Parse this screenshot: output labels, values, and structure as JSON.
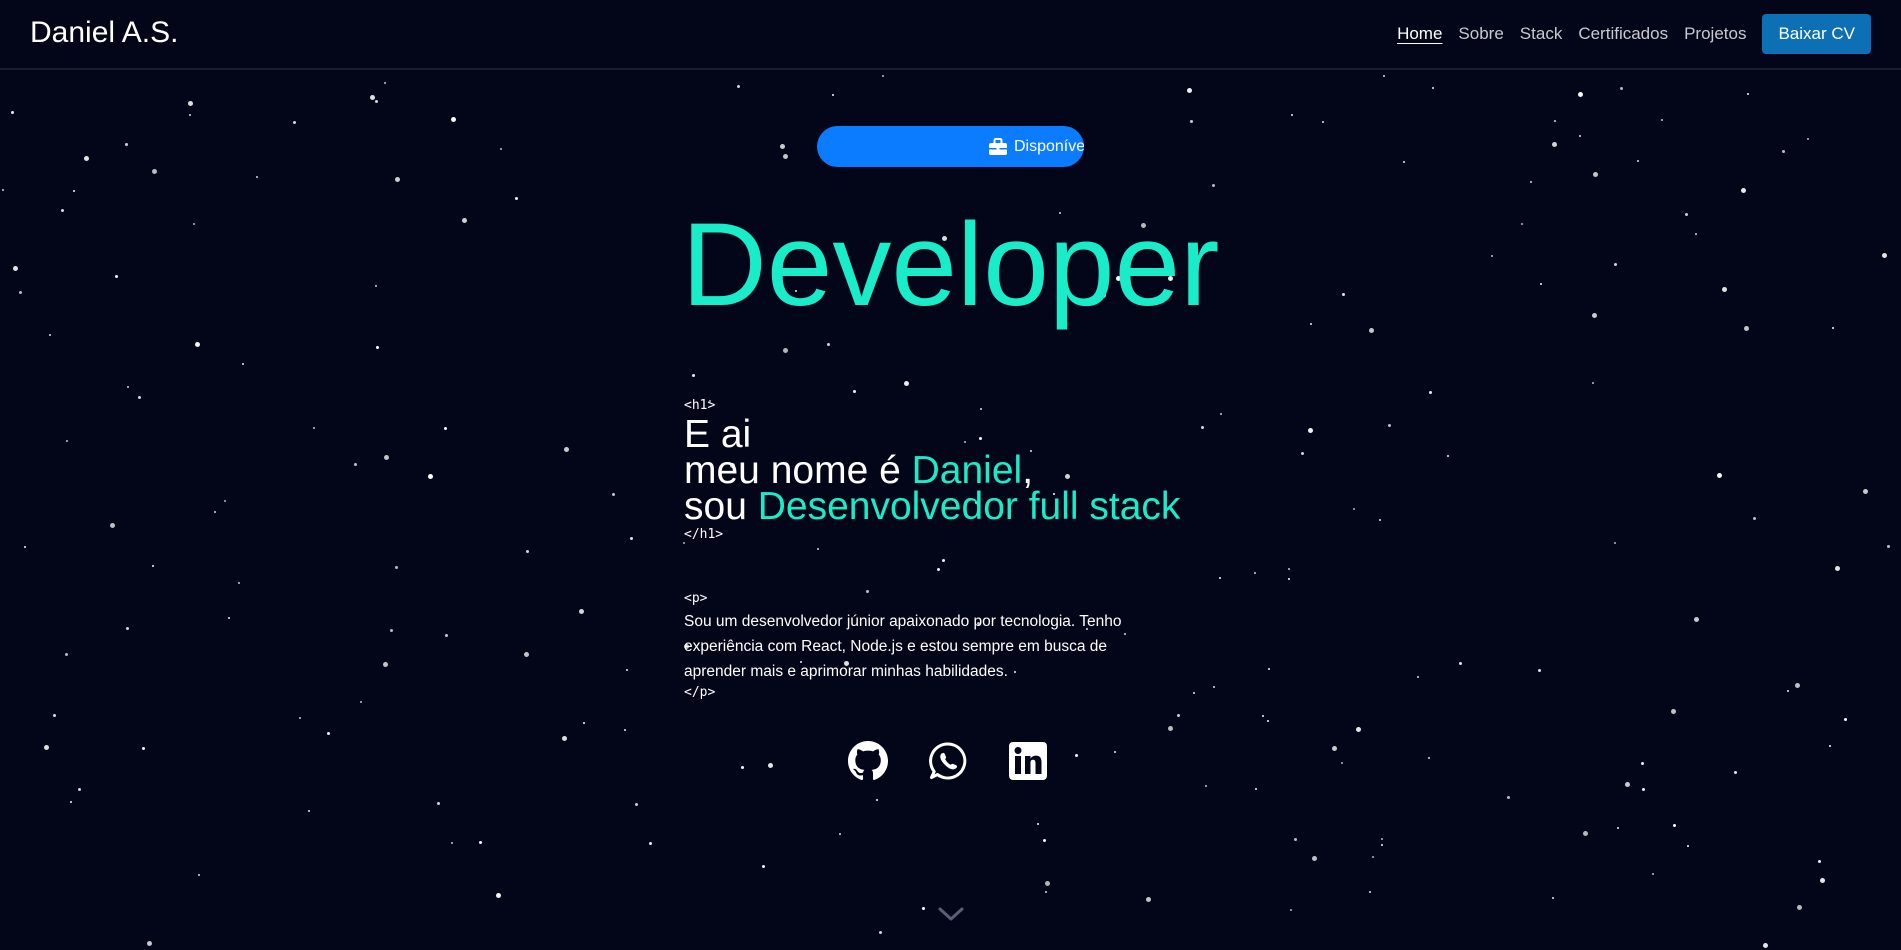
{
  "header": {
    "brand": "Daniel A.S.",
    "nav": [
      "Home",
      "Sobre",
      "Stack",
      "Certificados",
      "Projetos"
    ],
    "cta": "Baixar CV"
  },
  "hero": {
    "badge": "Disponível",
    "title": "Developer",
    "h1_open": "<h1>",
    "h1_close": "</h1>",
    "line1": "E ai",
    "line2_prefix": "meu nome é ",
    "line2_name": "Daniel",
    "line2_suffix": ",",
    "line3_prefix": "sou ",
    "line3_role": "Desenvolvedor full stack",
    "p_open": "<p>",
    "p_close": "</p>",
    "description": "Sou um desenvolvedor júnior apaixonado por tecnologia. Tenho experiência com React, Node.js e estou sempre em busca de aprender mais e aprimorar minhas habilidades."
  },
  "social_icons": [
    "github-icon",
    "whatsapp-icon",
    "linkedin-icon"
  ],
  "colors": {
    "background": "#030618",
    "accent": "#19ecc8",
    "badge": "#0b7bff",
    "cta": "#0d6fb4"
  }
}
